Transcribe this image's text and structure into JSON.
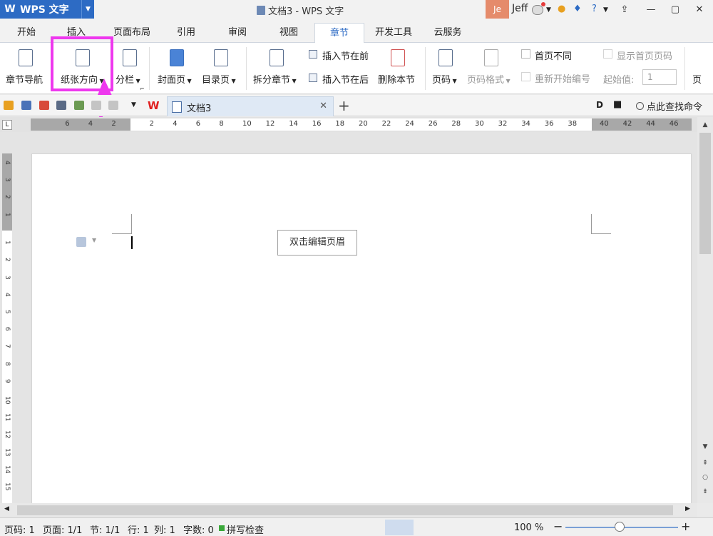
{
  "app": {
    "logo": "W",
    "name": "WPS 文字",
    "window_title": "文档3 - WPS 文字"
  },
  "user": {
    "initials": "Je",
    "name": "Jeff"
  },
  "tabs": [
    {
      "label": "开始"
    },
    {
      "label": "插入"
    },
    {
      "label": "页面布局"
    },
    {
      "label": "引用"
    },
    {
      "label": "审阅"
    },
    {
      "label": "视图"
    },
    {
      "label": "章节",
      "active": true
    },
    {
      "label": "开发工具"
    },
    {
      "label": "云服务"
    }
  ],
  "ribbon": {
    "chapter_nav": "章节导航",
    "paper_orientation": "纸张方向",
    "columns": "分栏",
    "cover": "封面页",
    "toc": "目录页",
    "split_chapter": "拆分章节",
    "insert_section_before": "插入节在前",
    "insert_section_after": "插入节在后",
    "delete_section": "删除本节",
    "page_number": "页码",
    "page_number_format": "页码格式",
    "first_page_diff": "首页不同",
    "restart_numbering": "重新开始编号",
    "show_first_page_number": "显示首页页码",
    "start_value_label": "起始值:",
    "start_value": "1",
    "cut_off": "页"
  },
  "doc_tab": {
    "name": "文档3",
    "find_label": "点此查找命令"
  },
  "ruler": {
    "h_left": [
      "6",
      "4",
      "2"
    ],
    "h_main": [
      "2",
      "4",
      "6",
      "8",
      "10",
      "12",
      "14",
      "16",
      "18",
      "20",
      "22",
      "24",
      "26",
      "28",
      "30",
      "32",
      "34",
      "36",
      "38"
    ],
    "h_right": [
      "40",
      "42",
      "44",
      "46"
    ],
    "v_top": [
      "4",
      "3",
      "2",
      "1"
    ],
    "v_main": [
      "1",
      "2",
      "3",
      "4",
      "5",
      "6",
      "7",
      "8",
      "9",
      "10",
      "11",
      "12",
      "13",
      "14",
      "15"
    ]
  },
  "page": {
    "header_hint": "双击编辑页眉"
  },
  "status": {
    "page": "页码: 1",
    "pages": "页面: 1/1",
    "section": "节: 1/1",
    "line": "行: 1",
    "column": "列: 1",
    "word_count": "字数: 0",
    "spell_check": "拼写检查",
    "zoom": "100 %"
  },
  "colors": {
    "accent": "#2d6bc4",
    "highlight": "#ee38ee"
  }
}
